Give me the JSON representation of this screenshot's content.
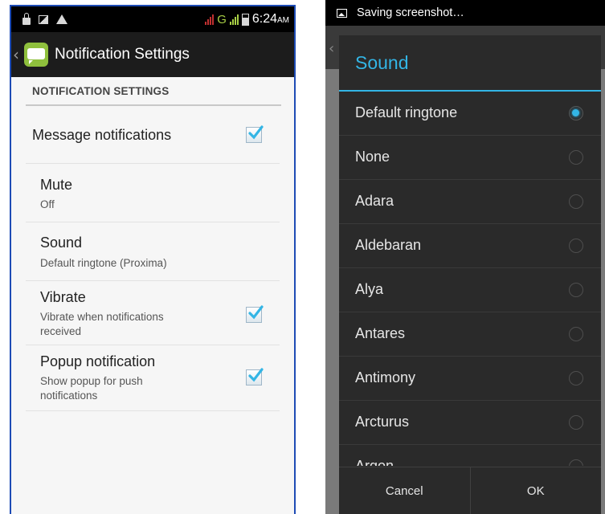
{
  "left": {
    "status_bar": {
      "time": "6:24",
      "ampm": "AM",
      "network": "G"
    },
    "action_bar": {
      "title": "Notification Settings"
    },
    "section_header": "NOTIFICATION SETTINGS",
    "prefs": {
      "message": {
        "title": "Message notifications",
        "checked": true
      },
      "mute": {
        "title": "Mute",
        "summary": "Off"
      },
      "sound": {
        "title": "Sound",
        "summary": "Default ringtone (Proxima)"
      },
      "vibrate": {
        "title": "Vibrate",
        "summary": "Vibrate when notifications received",
        "checked": true
      },
      "popup": {
        "title": "Popup notification",
        "summary": "Show popup for push notifications",
        "checked": true
      }
    }
  },
  "right": {
    "status_text": "Saving screenshot…",
    "dialog": {
      "title": "Sound",
      "options": [
        "Default ringtone",
        "None",
        "Adara",
        "Aldebaran",
        "Alya",
        "Antares",
        "Antimony",
        "Arcturus",
        "Argon"
      ],
      "selected_index": 0,
      "cancel_label": "Cancel",
      "ok_label": "OK"
    }
  },
  "colors": {
    "accent": "#33b5e5",
    "checkbox_check": "#33b5e5",
    "app_icon": "#8fc03d"
  }
}
